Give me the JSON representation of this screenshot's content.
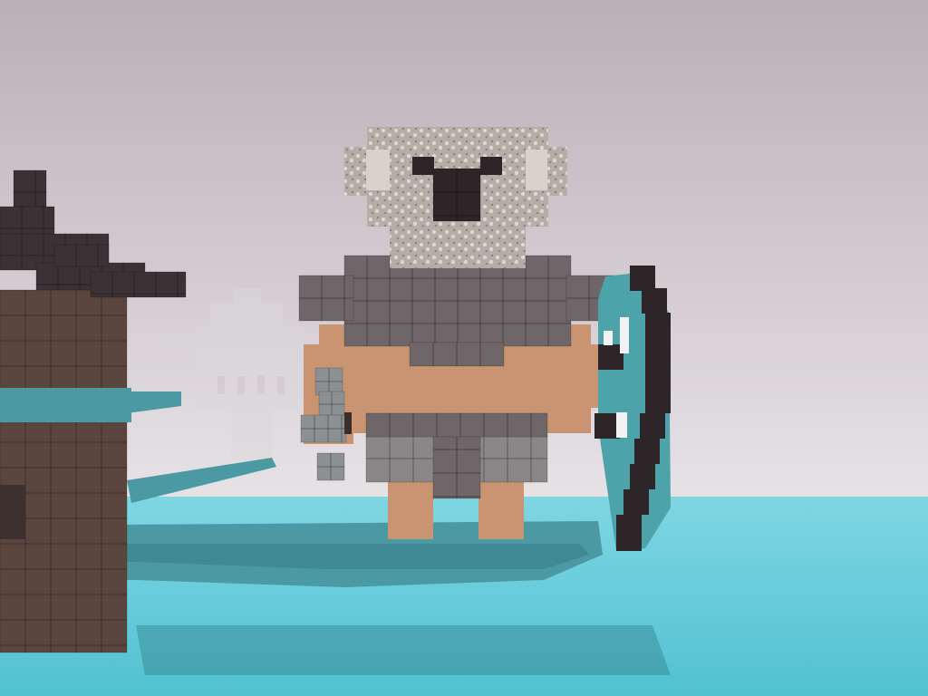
{
  "scene": {
    "description_visible_text": "",
    "colors": {
      "sky_top": "#b9b0b6",
      "sky_bottom": "#e7e3e6",
      "water": "#52c1d2",
      "water_light": "#7fd6e2",
      "platform": "#4b9aa3",
      "platform_dark": "#2f7880",
      "tower_brick": "#5b463f",
      "tower_roof": "#3a3234",
      "fog_castle": "#dcd8da",
      "koala_fur": "#b5ada6",
      "koala_fur_light": "#d8d2cb",
      "koala_dark": "#2d2527",
      "armor": "#6e6668",
      "skin": "#c89570",
      "skirt": "#8b8789",
      "shield_rim": "#2c2628",
      "shield_face": "#4ea2a9",
      "club": "#8d8f93"
    },
    "icons": {
      "character": "koala-warrior-icon",
      "shield": "shield-icon",
      "weapon": "stone-club-icon",
      "tower": "tower-icon",
      "castle": "castle-icon"
    }
  }
}
